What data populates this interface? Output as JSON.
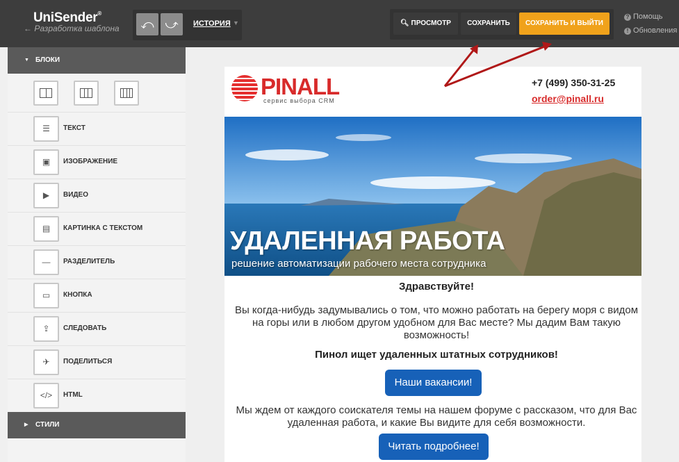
{
  "header": {
    "logo_text": "UniSender",
    "logo_mark": "®",
    "back_link": "← Разработка шаблона",
    "history_label": "ИСТОРИЯ",
    "preview_label": "ПРОСМОТР",
    "save_label": "СОХРАНИТЬ",
    "save_exit_label": "СОХРАНИТЬ И ВЫЙТИ",
    "help_label": "Помощь",
    "updates_label": "Обновления"
  },
  "sidebar": {
    "blocks_title": "БЛОКИ",
    "styles_title": "СТИЛИ",
    "items": [
      {
        "label": "ТЕКСТ",
        "icon": "text-icon"
      },
      {
        "label": "ИЗОБРАЖЕНИЕ",
        "icon": "image-icon"
      },
      {
        "label": "ВИДЕО",
        "icon": "video-icon"
      },
      {
        "label": "КАРТИНКА С ТЕКСТОМ",
        "icon": "image-text-icon"
      },
      {
        "label": "РАЗДЕЛИТЕЛЬ",
        "icon": "divider-icon"
      },
      {
        "label": "КНОПКА",
        "icon": "button-icon"
      },
      {
        "label": "СЛЕДОВАТЬ",
        "icon": "follow-icon"
      },
      {
        "label": "ПОДЕЛИТЬСЯ",
        "icon": "share-icon"
      },
      {
        "label": "HTML",
        "icon": "html-icon"
      }
    ]
  },
  "email": {
    "brand": "PINALL",
    "brand_tagline": "сервис выбора CRM",
    "phone": "+7 (499) 350-31-25",
    "email": "order@pinall.ru",
    "banner_title": "УДАЛЕННАЯ РАБОТА",
    "banner_subtitle": "решение автоматизации рабочего места сотрудника",
    "greeting": "Здравствуйте!",
    "paragraph1": "Вы когда-нибудь задумывались о том, что можно работать на берегу моря с видом на горы или в любом другом удобном для Вас месте? Мы дадим Вам такую возможность!",
    "headline": "Пинол ищет удаленных штатных сотрудников!",
    "button1": "Наши вакансии!",
    "paragraph2": "Мы ждем от каждого соискателя темы на нашем форуме с рассказом, что для Вас удаленная работа, и какие Вы видите для себя возможности.",
    "button2": "Читать подробнее!"
  },
  "colors": {
    "topbar": "#3d3d3d",
    "accent": "#f0a21b",
    "cta": "#1761b8",
    "brand_red": "#d82b2b",
    "arrow": "#b01818"
  }
}
